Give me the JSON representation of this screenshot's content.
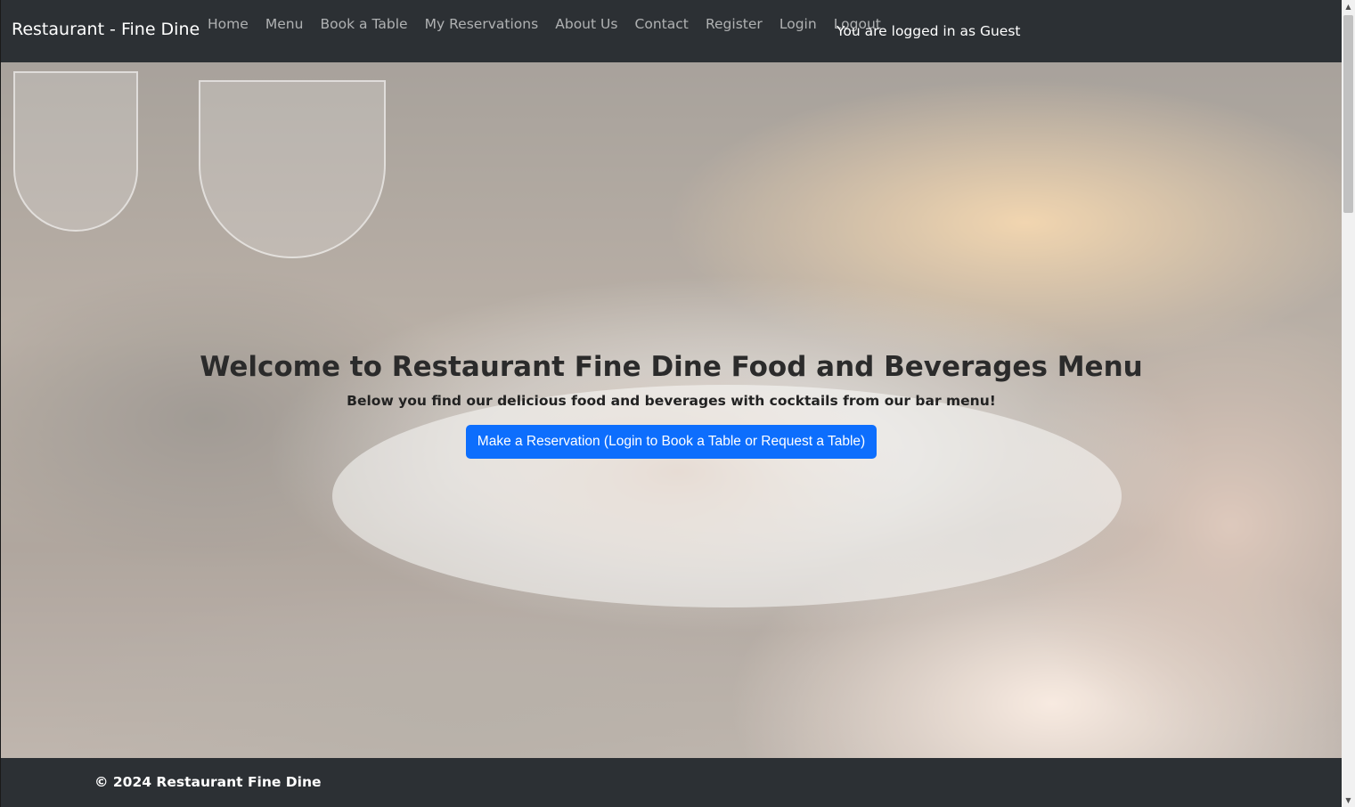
{
  "navbar": {
    "brand": "Restaurant - Fine Dine",
    "links": [
      "Home",
      "Menu",
      "Book a Table",
      "My Reservations",
      "About Us",
      "Contact",
      "Register",
      "Login",
      "Logout"
    ],
    "status": "You are logged in as Guest"
  },
  "hero": {
    "title": "Welcome to Restaurant Fine Dine Food and Beverages Menu",
    "subtitle": "Below you find our delicious food and beverages with cocktails from our bar menu!",
    "cta_label": "Make a Reservation (Login to Book a Table or Request a Table)"
  },
  "footer": {
    "text": "© 2024 Restaurant Fine Dine"
  },
  "scrollbar": {
    "up_icon": "▲",
    "down_icon": "▼"
  },
  "colors": {
    "navbar_bg": "#2c3034",
    "primary_button": "#0d6efd"
  }
}
